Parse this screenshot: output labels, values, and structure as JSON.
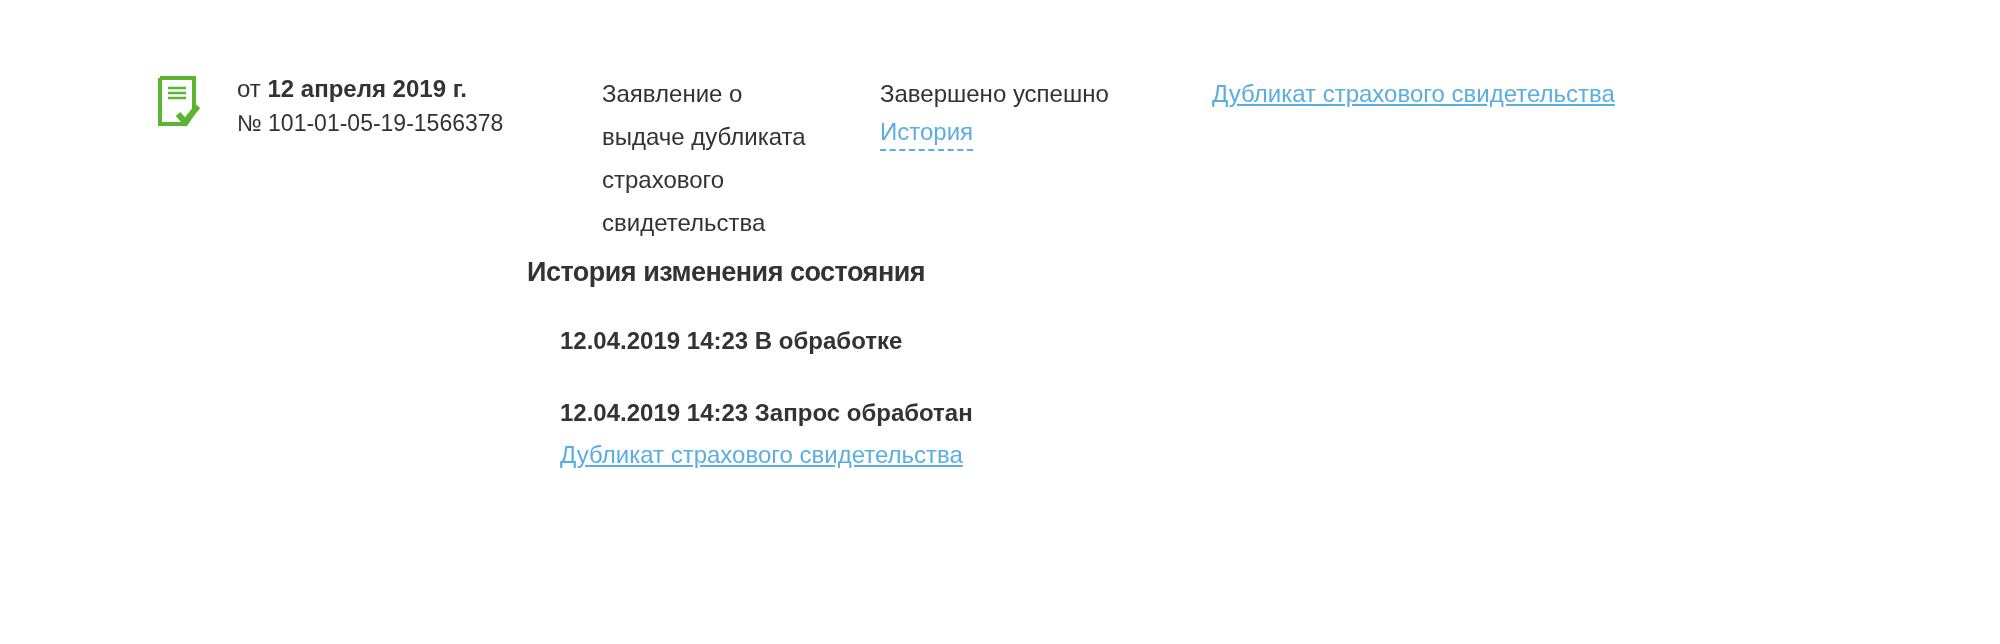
{
  "application": {
    "date": "от **12 апреля 2019 г.**",
    "number": "№ 101-01-05-19-1566378",
    "description": "Заявление о выдаче дубликата страхового свидетельства",
    "status": "Завершено успешно",
    "history_link": "История",
    "document_link": "Дубликат страхового свидетельства"
  },
  "history": {
    "title": "История изменения состояния",
    "entries": [
      {
        "text": "12.04.2019 14:23 В обработке"
      },
      {
        "text": "12.04.2019 14:23 Запрос обработан",
        "link": "Дубликат страхового свидетельства"
      }
    ]
  }
}
